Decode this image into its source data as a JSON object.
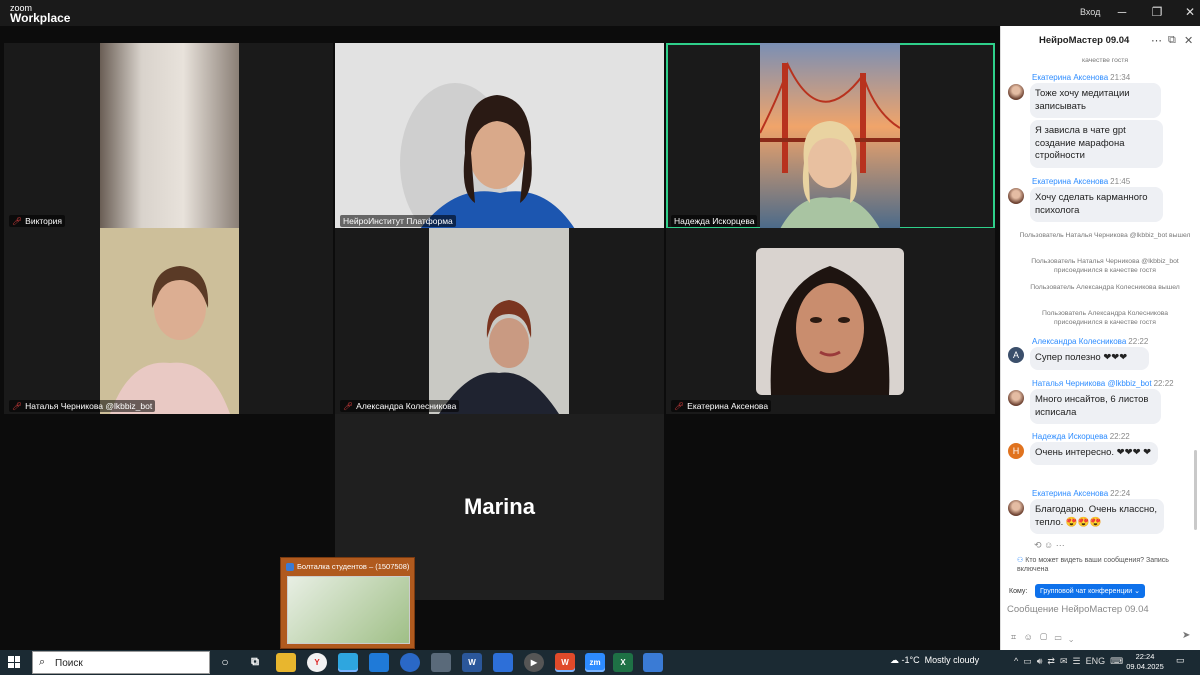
{
  "app": {
    "brand_small": "zoom",
    "brand": "Workplace",
    "signin": "Вход",
    "min": "─",
    "max": "❐",
    "close": "✕"
  },
  "participants": [
    {
      "name": "Виктория",
      "muted": true
    },
    {
      "name": "НейроИнститут Платформа",
      "muted": false
    },
    {
      "name": "Надежда Искорцева",
      "muted": false,
      "active_speaker": true
    },
    {
      "name": "Наталья Черникова @lkbbiz_bot",
      "muted": true
    },
    {
      "name": "Александра  Колесникова",
      "muted": true
    },
    {
      "name": "Екатерина Аксенова",
      "muted": true
    },
    {
      "name": "Marina",
      "camera": "off"
    }
  ],
  "popup": {
    "title": "Болталка студентов – (1507508)"
  },
  "chat": {
    "title": "НейроМастер 09.04",
    "top_system": "качестве гостя",
    "messages": [
      {
        "sender": "Екатерина Аксенова",
        "time": "21:34",
        "texts": [
          "Тоже хочу медитации записывать",
          "Я зависла в чате gpt создание марафона стройности"
        ]
      },
      {
        "sender": "Екатерина Аксенова",
        "time": "21:45",
        "texts": [
          "Хочу сделать карманного психолога"
        ]
      },
      {
        "sender": "Александра  Колесникова",
        "time": "22:22",
        "avatar_letter": "A",
        "avatar_color": "#3b4f6b",
        "texts": [
          "Супер полезно ❤❤❤"
        ]
      },
      {
        "sender": "Наталья Черникова @lkbbiz_bot",
        "time": "22:22",
        "texts": [
          "Много инсайтов, 6 листов исписала"
        ]
      },
      {
        "sender": "Надежда Искорцева",
        "time": "22:22",
        "avatar_letter": "H",
        "avatar_color": "#e0731f",
        "texts": [
          "Очень интересно. ❤❤❤ ❤"
        ]
      },
      {
        "sender": "Екатерина Аксенова",
        "time": "22:24",
        "texts": [
          "Благодарю. Очень классно, тепло. 😍😍😍"
        ]
      }
    ],
    "system": [
      "Пользователь Наталья Черникова @lkbbiz_bot вышел",
      "Пользователь Наталья Черникова @lkbbiz_bot присоединился в качестве гостя",
      "Пользователь Александра Колесникова вышел",
      "Пользователь Александра Колесникова присоединился в качестве гостя"
    ],
    "notice": "Кто может видеть ваши сообщения? Запись включена",
    "to_label": "Кому:",
    "to_value": "Групповой чат конференции ⌄",
    "input_placeholder": "Сообщение НейроМастер 09.04"
  },
  "taskbar": {
    "search": "Поиск",
    "weather_temp": "-1°C",
    "weather_text": "Mostly cloudy",
    "lang": "ENG",
    "time": "22:24",
    "date": "09.04.2025"
  }
}
